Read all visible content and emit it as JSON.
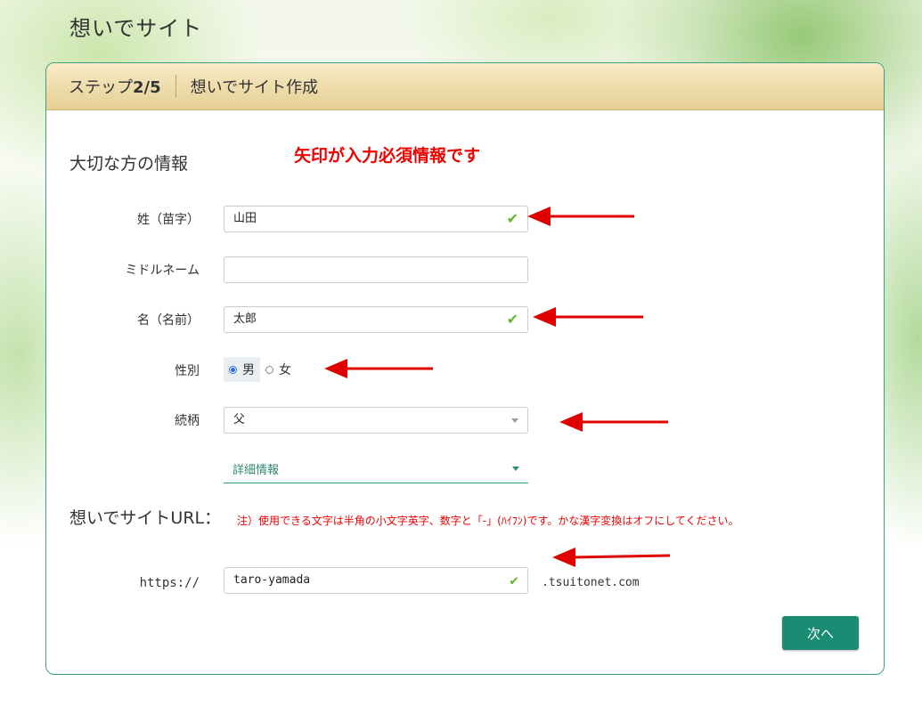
{
  "page_title": "想いでサイト",
  "header": {
    "step_prefix": "ステップ",
    "step_number": "2/5",
    "title": "想いでサイト作成"
  },
  "section": {
    "title": "大切な方の情報",
    "notice": "矢印が入力必須情報です"
  },
  "fields": {
    "last_name": {
      "label": "姓（苗字）",
      "value": "山田"
    },
    "middle_name": {
      "label": "ミドルネーム",
      "value": ""
    },
    "first_name": {
      "label": "名（名前）",
      "value": "太郎"
    },
    "gender": {
      "label": "性別",
      "options": [
        "男",
        "女"
      ],
      "selected": "男"
    },
    "relation": {
      "label": "続柄",
      "value": "父"
    },
    "details": {
      "label": "詳細情報"
    }
  },
  "url": {
    "title": "想いでサイトURL：",
    "note": "注）使用できる文字は半角の小文字英字、数字と「-」(ﾊｲﾌﾝ)です。かな漢字変換はオフにしてください。",
    "prefix": "https://",
    "value": "taro-yamada",
    "domain": ".tsuitonet.com"
  },
  "buttons": {
    "next": "次へ"
  },
  "colors": {
    "accent": "#1a8c74",
    "arrow": "#e00000",
    "check": "#62b82e",
    "header_bg": "#ead596"
  }
}
